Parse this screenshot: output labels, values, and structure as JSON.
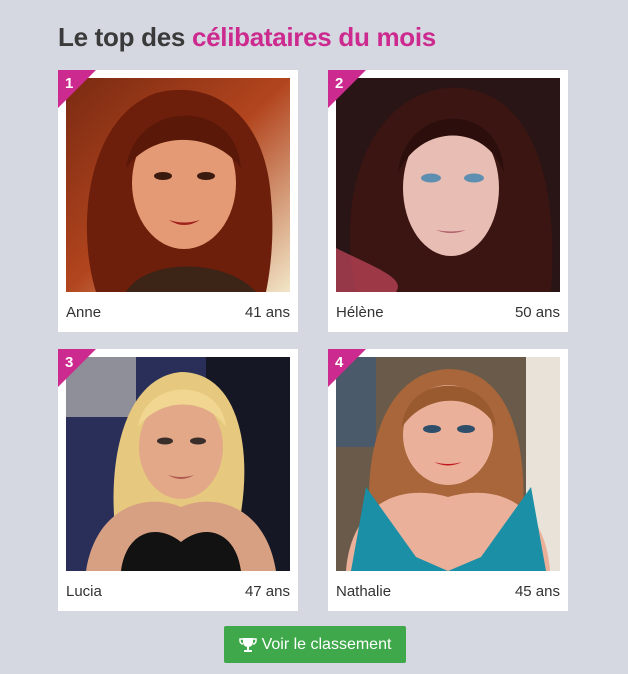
{
  "section": {
    "title_prefix": "Le top des",
    "title_accent": "célibataires du mois",
    "accent_color": "#cc2a8e"
  },
  "profiles": [
    {
      "rank": "1",
      "name": "Anne",
      "age": "41 ans"
    },
    {
      "rank": "2",
      "name": "Hélène",
      "age": "50 ans"
    },
    {
      "rank": "3",
      "name": "Lucia",
      "age": "47 ans"
    },
    {
      "rank": "4",
      "name": "Nathalie",
      "age": "45 ans"
    }
  ],
  "cta": {
    "label": "Voir le classement",
    "icon": "trophy-icon",
    "color": "#3ea84a"
  }
}
